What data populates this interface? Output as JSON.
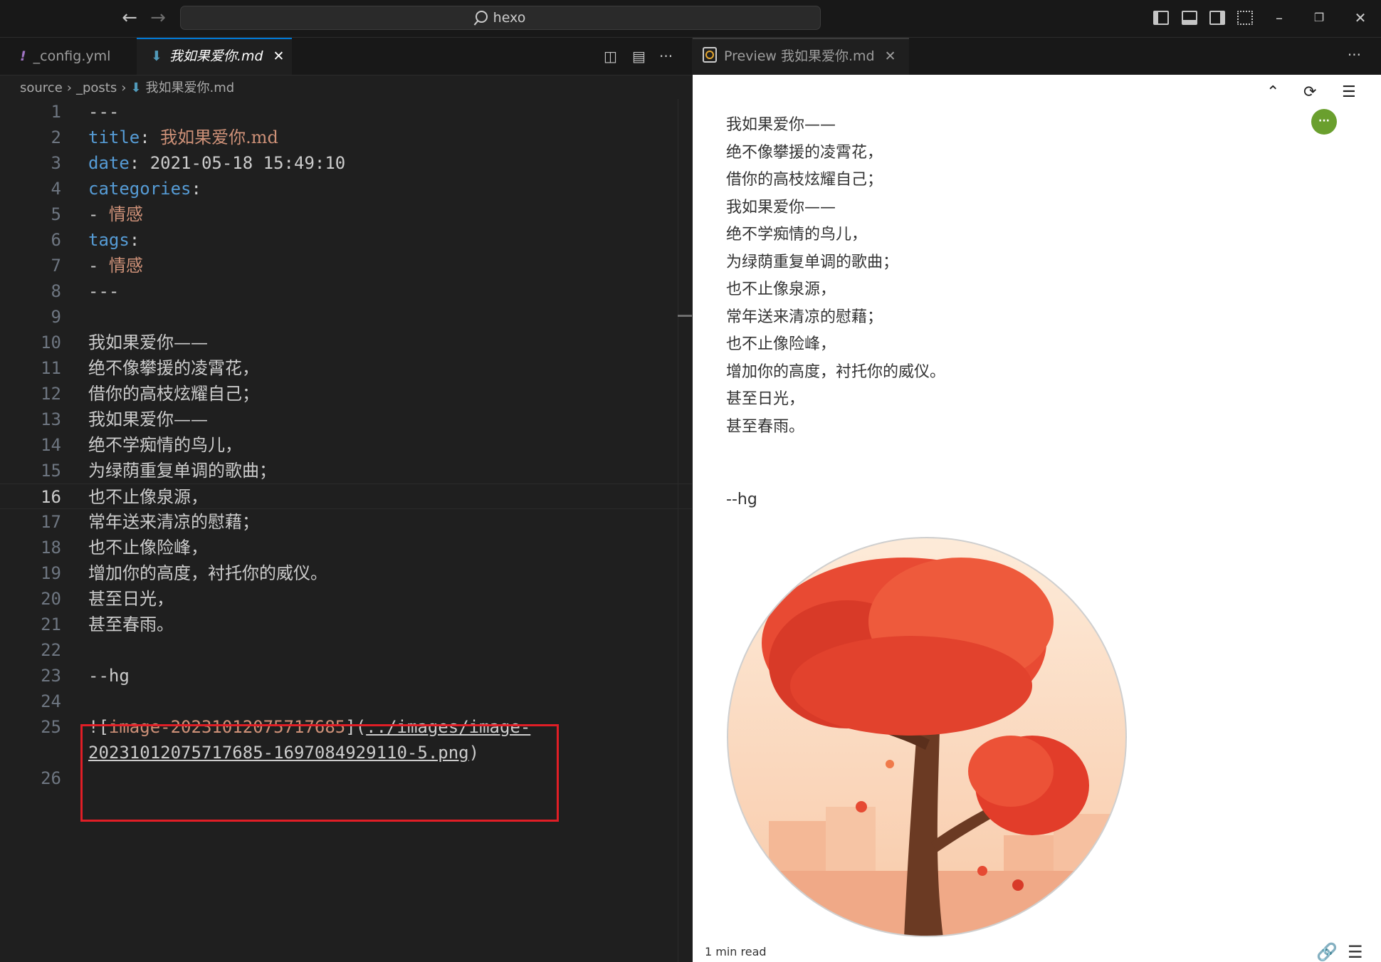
{
  "titlebar": {
    "back_icon": "arrow-left-icon",
    "forward_icon": "arrow-right-icon",
    "search_text": "hexo",
    "layout_icons": [
      "toggle-primary-sidebar-icon",
      "toggle-panel-icon",
      "toggle-secondary-sidebar-icon",
      "customize-layout-icon"
    ],
    "window_controls": [
      "minimize-icon",
      "restore-icon",
      "close-icon"
    ]
  },
  "editor": {
    "tabs": [
      {
        "icon": "!",
        "label": "_config.yml",
        "active": false
      },
      {
        "icon": "⬇",
        "label": "我如果爱你.md",
        "active": true,
        "close": "✕"
      }
    ],
    "actions": [
      "open-preview-to-side-icon",
      "split-editor-icon",
      "more-actions-icon"
    ],
    "breadcrumb": [
      "source",
      "_posts",
      "我如果爱你.md"
    ],
    "lines": [
      {
        "n": "1",
        "text": "---"
      },
      {
        "n": "2",
        "key": "title",
        "value": "我如果爱你.md"
      },
      {
        "n": "3",
        "key": "date",
        "value": "2021-05-18 15:49:10"
      },
      {
        "n": "4",
        "key": "categories",
        "value": ""
      },
      {
        "n": "5",
        "item": "情感"
      },
      {
        "n": "6",
        "key": "tags",
        "value": ""
      },
      {
        "n": "7",
        "item": "情感"
      },
      {
        "n": "8",
        "text": "---"
      },
      {
        "n": "9",
        "text": ""
      },
      {
        "n": "10",
        "text": "我如果爱你——"
      },
      {
        "n": "11",
        "text": "绝不像攀援的凌霄花，"
      },
      {
        "n": "12",
        "text": "借你的高枝炫耀自己；"
      },
      {
        "n": "13",
        "text": "我如果爱你——"
      },
      {
        "n": "14",
        "text": "绝不学痴情的鸟儿，"
      },
      {
        "n": "15",
        "text": "为绿荫重复单调的歌曲；"
      },
      {
        "n": "16",
        "text": "也不止像泉源，"
      },
      {
        "n": "17",
        "text": "常年送来清凉的慰藉；"
      },
      {
        "n": "18",
        "text": "也不止像险峰，"
      },
      {
        "n": "19",
        "text": "增加你的高度，衬托你的威仪。"
      },
      {
        "n": "20",
        "text": "甚至日光，"
      },
      {
        "n": "21",
        "text": "甚至春雨。"
      },
      {
        "n": "22",
        "text": ""
      },
      {
        "n": "23",
        "text": "--hg"
      },
      {
        "n": "24",
        "text": ""
      },
      {
        "n": "25",
        "image_alt": "image-20231012075717685",
        "image_path_1": "../images/image-",
        "image_path_2": "20231012075717685-1697084929110-5.png"
      },
      {
        "n": "26",
        "text": ""
      }
    ],
    "current_line": "16"
  },
  "preview": {
    "tab_label": "Preview 我如果爱你.md",
    "tab_close": "✕",
    "tools": [
      "chevron-up-icon",
      "refresh-icon",
      "table-of-contents-icon"
    ],
    "badge": "···",
    "poem": [
      "我如果爱你——",
      "绝不像攀援的凌霄花，",
      "借你的高枝炫耀自己；",
      "我如果爱你——",
      "绝不学痴情的鸟儿，",
      "为绿荫重复单调的歌曲；",
      "也不止像泉源，",
      "常年送来清凉的慰藉；",
      "也不止像险峰，",
      "增加你的高度，衬托你的威仪。",
      "甚至日光，",
      "甚至春雨。"
    ],
    "signature": "--hg",
    "image_name": "red-tree-illustration",
    "read_time": "1 min read",
    "footer_icons": [
      "link-icon",
      "menu-icon"
    ]
  },
  "colors": {
    "keyword": "#569cd6",
    "string": "#ce9178",
    "highlight_border": "#e01e26",
    "tab_active_border": "#0078d4"
  }
}
